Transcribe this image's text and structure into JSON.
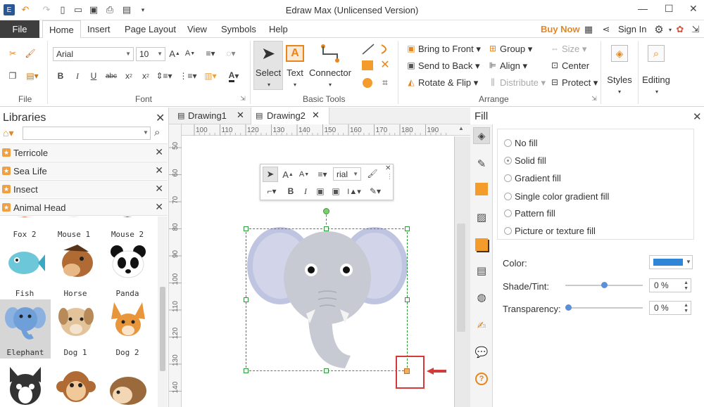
{
  "app": {
    "title": "Edraw Max (Unlicensed Version)",
    "buy_now": "Buy Now",
    "sign_in": "Sign In"
  },
  "menu": {
    "file": "File",
    "tabs": [
      "Home",
      "Insert",
      "Page Layout",
      "View",
      "Symbols",
      "Help"
    ]
  },
  "ribbon": {
    "font_name": "Arial",
    "font_size": "10",
    "groups": {
      "file": "File",
      "font": "Font",
      "basic_tools": "Basic Tools",
      "arrange": "Arrange"
    },
    "tools": {
      "select": "Select",
      "text": "Text",
      "connector": "Connector"
    },
    "arrange": {
      "bring_to_front": "Bring to Front",
      "send_to_back": "Send to Back",
      "rotate_flip": "Rotate & Flip",
      "group": "Group",
      "align": "Align",
      "distribute": "Distribute",
      "size": "Size",
      "center": "Center",
      "protect": "Protect"
    },
    "styles": "Styles",
    "editing": "Editing"
  },
  "libraries": {
    "title": "Libraries",
    "search_value": "",
    "items": [
      "Terricole",
      "Sea Life",
      "Insect",
      "Animal Head"
    ],
    "shapes": [
      "Fox 2",
      "Mouse 1",
      "Mouse 2",
      "Fish",
      "Horse",
      "Panda",
      "Elephant",
      "Dog 1",
      "Dog 2"
    ]
  },
  "documents": {
    "tabs": [
      "Drawing1",
      "Drawing2"
    ],
    "active": "Drawing2"
  },
  "ruler": {
    "h_ticks": [
      "100",
      "110",
      "120",
      "130",
      "140",
      "150",
      "160",
      "170",
      "180",
      "190"
    ],
    "v_ticks": [
      "50",
      "60",
      "70",
      "80",
      "90",
      "100",
      "110",
      "120",
      "130",
      "140"
    ]
  },
  "floatbar": {
    "font": "rial"
  },
  "fill": {
    "title": "Fill",
    "options": [
      "No fill",
      "Solid fill",
      "Gradient fill",
      "Single color gradient fill",
      "Pattern fill",
      "Picture or texture fill"
    ],
    "selected": "Solid fill",
    "color_label": "Color:",
    "color_value": "#2f86d6",
    "shade_label": "Shade/Tint:",
    "shade_value": "0 %",
    "shade_level": 0.5,
    "transparency_label": "Transparency:",
    "transparency_value": "0 %",
    "transparency_level": 0
  },
  "colors": {
    "accent": "#e8861b",
    "selection_box": "#2f9a3a",
    "highlight": "#d43a3a",
    "elephant": "#c7cad3"
  }
}
